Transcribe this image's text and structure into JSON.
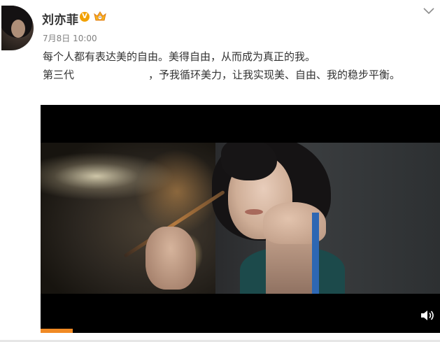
{
  "post": {
    "author": "刘亦菲",
    "timestamp": "7月8日 10:00",
    "text_line_1": "每个人都有表达美的自由。美得自由，从而成为真正的我。",
    "text_line_2_before": "第三代",
    "text_line_2_after": "，予我循环美力，让我实现美、自由、我的稳步平衡。"
  },
  "badges": {
    "verified_mark": "V",
    "verified_color": "#f2a100",
    "vip_icon": "crown-vip-icon"
  },
  "video": {
    "progress": 0.08,
    "progress_color": "#f08a24",
    "volume_icon": "volume-icon"
  },
  "icons": {
    "menu": "chevron-down-icon"
  }
}
